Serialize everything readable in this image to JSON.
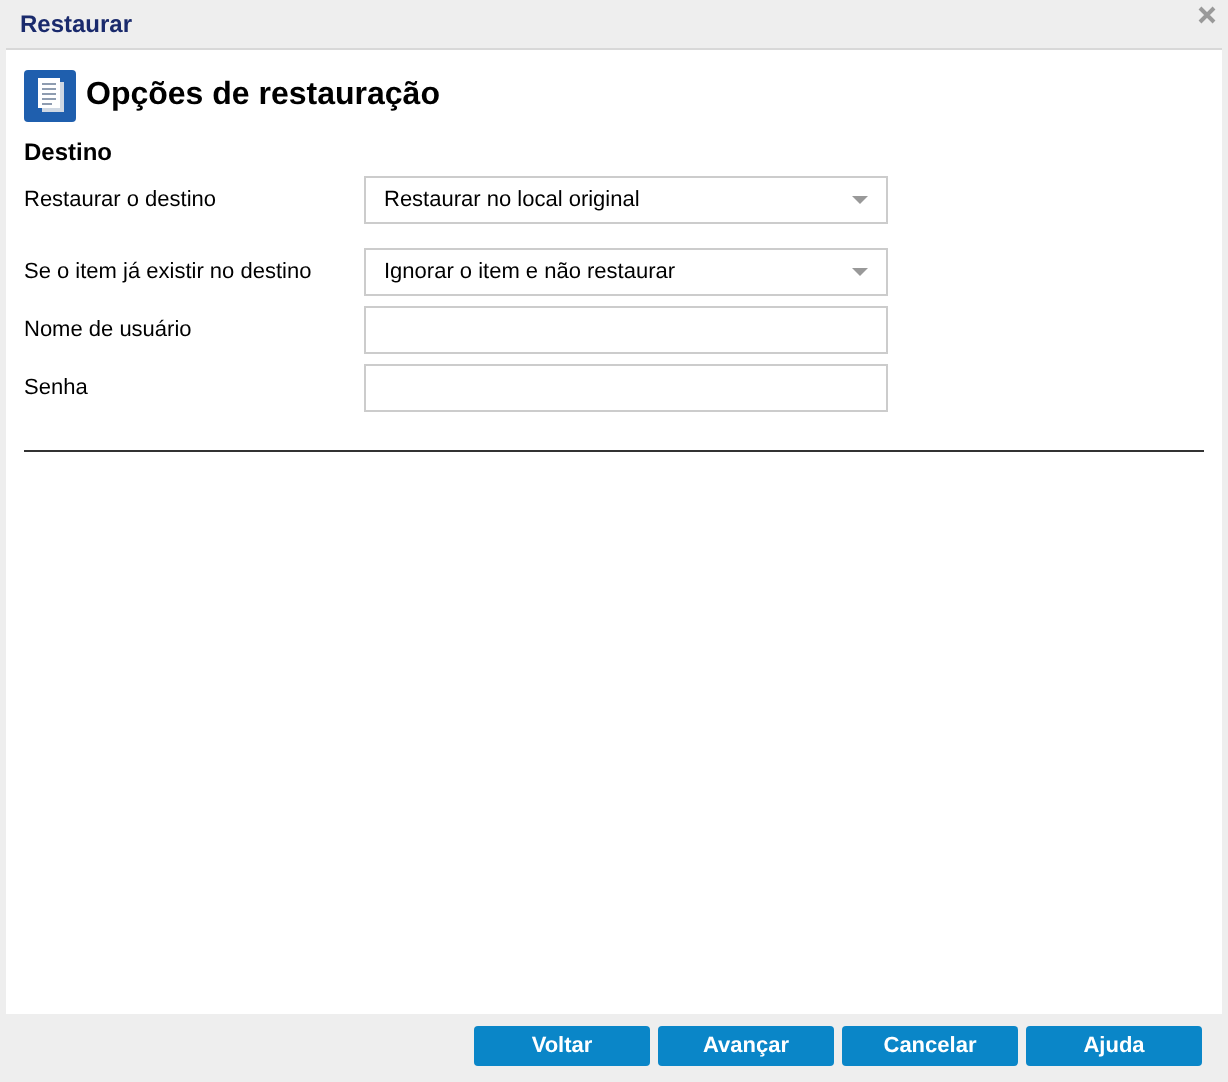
{
  "window": {
    "title": "Restaurar"
  },
  "heading": "Opções de restauração",
  "section": "Destino",
  "fields": [
    {
      "label": "Restaurar o destino",
      "kind": "select",
      "value": "Restaurar no local original"
    },
    {
      "label": "Se o item já existir no destino",
      "kind": "select",
      "value": "Ignorar o item e não restaurar"
    },
    {
      "label": "Nome de usuário",
      "kind": "text"
    },
    {
      "label": "Senha",
      "kind": "password"
    }
  ],
  "buttons": [
    "Voltar",
    "Avançar",
    "Cancelar",
    "Ajuda"
  ]
}
